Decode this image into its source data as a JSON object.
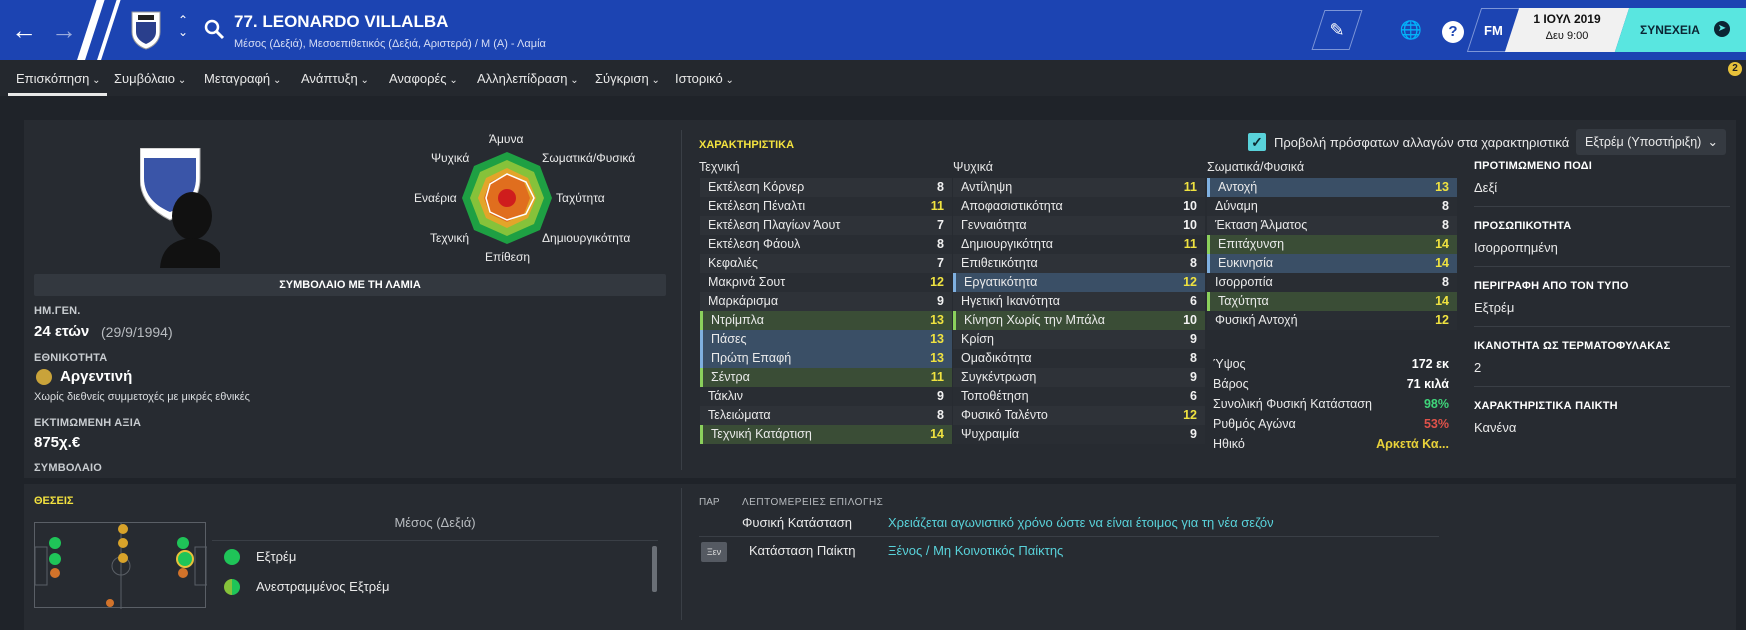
{
  "header": {
    "player_name": "77. LEONARDO VILLALBA",
    "subtitle": "Μέσος (Δεξιά), Μεσοεπιθετικός (Δεξιά, Αριστερά) / Μ (Α) - Λαμία",
    "date": "1 ΙΟΥΛ 2019",
    "time": "Δευ 9:00",
    "continue_label": "ΣΥΝΕΧΕΙΑ",
    "fm_label": "FM",
    "back_icon": "arrow-left-icon",
    "forward_icon": "arrow-right-icon",
    "search_icon": "search-icon",
    "help_icon": "help-icon"
  },
  "tabs": [
    "Επισκόπηση",
    "Συμβόλαιο",
    "Μεταγραφή",
    "Ανάπτυξη",
    "Αναφορές",
    "Αλληλεπίδραση",
    "Σύγκριση",
    "Ιστορικό"
  ],
  "notif_count": "2",
  "profile": {
    "contract_with": "ΣΥΜΒΟΛΑΙΟ ΜΕ ΤΗ ΛΑΜΙΑ",
    "dob_label": "ΗΜ.ΓΕΝ.",
    "age": "24 ετών",
    "dob": "(29/9/1994)",
    "nationality_label": "ΕΘΝΙΚΟΤΗΤΑ",
    "nationality": "Αργεντινή",
    "caps_note": "Χωρίς διεθνείς συμμετοχές με μικρές εθνικές",
    "value_label": "ΕΚΤΙΜΩΜΕΝΗ ΑΞΙΑ",
    "value": "875χ.€",
    "contract_label": "ΣΥΜΒΟΛΑΙΟ"
  },
  "radar": {
    "labels": {
      "top": "Άμυνα",
      "top_right": "Σωματικά/Φυσικά",
      "right": "Ταχύτητα",
      "bottom_right": "Δημιουργικότητα",
      "bottom": "Επίθεση",
      "bottom_left": "Τεχνική",
      "left": "Εναέρια",
      "top_left": "Ψυχικά"
    }
  },
  "attributes": {
    "title": "ΧΑΡΑΚΤΗΡΙΣΤΙΚΑ",
    "show_changes_label": "Προβολή πρόσφατων αλλαγών στα χαρακτηριστικά",
    "role_select": "Εξτρέμ (Υποστήριξη)",
    "technical_header": "Τεχνική",
    "mental_header": "Ψυχικά",
    "physical_header": "Σωματικά/Φυσικά",
    "technical": [
      {
        "name": "Εκτέλεση Κόρνερ",
        "value": "8",
        "hl": ""
      },
      {
        "name": "Εκτέλεση Πέναλτι",
        "value": "11",
        "hl": ""
      },
      {
        "name": "Εκτέλεση Πλαγίων Άουτ",
        "value": "7",
        "hl": ""
      },
      {
        "name": "Εκτέλεση Φάουλ",
        "value": "8",
        "hl": ""
      },
      {
        "name": "Κεφαλιές",
        "value": "7",
        "hl": ""
      },
      {
        "name": "Μακρινά Σουτ",
        "value": "12",
        "hl": ""
      },
      {
        "name": "Μαρκάρισμα",
        "value": "9",
        "hl": ""
      },
      {
        "name": "Ντρίμπλα",
        "value": "13",
        "hl": "green"
      },
      {
        "name": "Πάσες",
        "value": "13",
        "hl": "blue"
      },
      {
        "name": "Πρώτη Επαφή",
        "value": "13",
        "hl": "blue"
      },
      {
        "name": "Σέντρα",
        "value": "11",
        "hl": "green"
      },
      {
        "name": "Τάκλιν",
        "value": "9",
        "hl": ""
      },
      {
        "name": "Τελειώματα",
        "value": "8",
        "hl": ""
      },
      {
        "name": "Τεχνική Κατάρτιση",
        "value": "14",
        "hl": "green"
      }
    ],
    "mental": [
      {
        "name": "Αντίληψη",
        "value": "11",
        "hl": ""
      },
      {
        "name": "Αποφασιστικότητα",
        "value": "10",
        "hl": ""
      },
      {
        "name": "Γενναιότητα",
        "value": "10",
        "hl": ""
      },
      {
        "name": "Δημιουργικότητα",
        "value": "11",
        "hl": ""
      },
      {
        "name": "Επιθετικότητα",
        "value": "8",
        "hl": ""
      },
      {
        "name": "Εργατικότητα",
        "value": "12",
        "hl": "blue"
      },
      {
        "name": "Ηγετική Ικανότητα",
        "value": "6",
        "hl": ""
      },
      {
        "name": "Κίνηση Χωρίς την Μπάλα",
        "value": "10",
        "hl": "green"
      },
      {
        "name": "Κρίση",
        "value": "9",
        "hl": ""
      },
      {
        "name": "Ομαδικότητα",
        "value": "8",
        "hl": ""
      },
      {
        "name": "Συγκέντρωση",
        "value": "9",
        "hl": ""
      },
      {
        "name": "Τοποθέτηση",
        "value": "6",
        "hl": ""
      },
      {
        "name": "Φυσικό Ταλέντο",
        "value": "12",
        "hl": ""
      },
      {
        "name": "Ψυχραιμία",
        "value": "9",
        "hl": ""
      }
    ],
    "physical": [
      {
        "name": "Αντοχή",
        "value": "13",
        "hl": "blue"
      },
      {
        "name": "Δύναμη",
        "value": "8",
        "hl": ""
      },
      {
        "name": "Έκταση Άλματος",
        "value": "8",
        "hl": ""
      },
      {
        "name": "Επιτάχυνση",
        "value": "14",
        "hl": "green"
      },
      {
        "name": "Ευκινησία",
        "value": "14",
        "hl": "blue"
      },
      {
        "name": "Ισορροπία",
        "value": "8",
        "hl": ""
      },
      {
        "name": "Ταχύτητα",
        "value": "14",
        "hl": "green"
      },
      {
        "name": "Φυσική Αντοχή",
        "value": "12",
        "hl": ""
      }
    ],
    "extra": [
      {
        "name": "Ύψος",
        "value": "172 εκ",
        "color": "#ffffff"
      },
      {
        "name": "Βάρος",
        "value": "71 κιλά",
        "color": "#ffffff"
      },
      {
        "name": "Συνολική Φυσική Κατάσταση",
        "value": "98%",
        "color": "#3fd57a"
      },
      {
        "name": "Ρυθμός Αγώνα",
        "value": "53%",
        "color": "#e0524a"
      },
      {
        "name": "Ηθικό",
        "value": "Αρκετά Κα...",
        "color": "#e9d23a"
      }
    ]
  },
  "right_info": [
    {
      "label": "ΠΡΟΤΙΜΩΜΕΝΟ ΠΟΔΙ",
      "value": "Δεξί"
    },
    {
      "label": "ΠΡΟΣΩΠΙΚΟΤΗΤΑ",
      "value": "Ισορροπημένη"
    },
    {
      "label": "ΠΕΡΙΓΡΑΦΗ ΑΠΟ ΤΟΝ ΤΥΠΟ",
      "value": "Εξτρέμ"
    },
    {
      "label": "ΙΚΑΝΟΤΗΤΑ ΩΣ ΤΕΡΜΑΤΟΦΥΛΑΚΑΣ",
      "value": "2"
    },
    {
      "label": "ΧΑΡΑΚΤΗΡΙΣΤΙΚΑ ΠΑΙΚΤΗ",
      "value": "Κανένα"
    }
  ],
  "positions": {
    "title": "ΘΕΣΕΙΣ",
    "current": "Μέσος (Δεξιά)",
    "roles": [
      "Εξτρέμ",
      "Ανεστραμμένος Εξτρέμ"
    ]
  },
  "selection": {
    "col1": "ΠΑΡ",
    "col2": "ΛΕΠΤΟΜΕΡΕΙΕΣ ΕΠΙΛΟΓΗΣ",
    "rows": [
      {
        "badge": "",
        "label": "Φυσική Κατάσταση",
        "value": "Χρειάζεται αγωνιστικό χρόνο ώστε να είναι έτοιμος για τη νέα σεζόν"
      },
      {
        "badge": "Ξεν",
        "label": "Κατάσταση Παίκτη",
        "value": "Ξένος / Μη Κοινοτικός Παίκτης"
      }
    ]
  }
}
